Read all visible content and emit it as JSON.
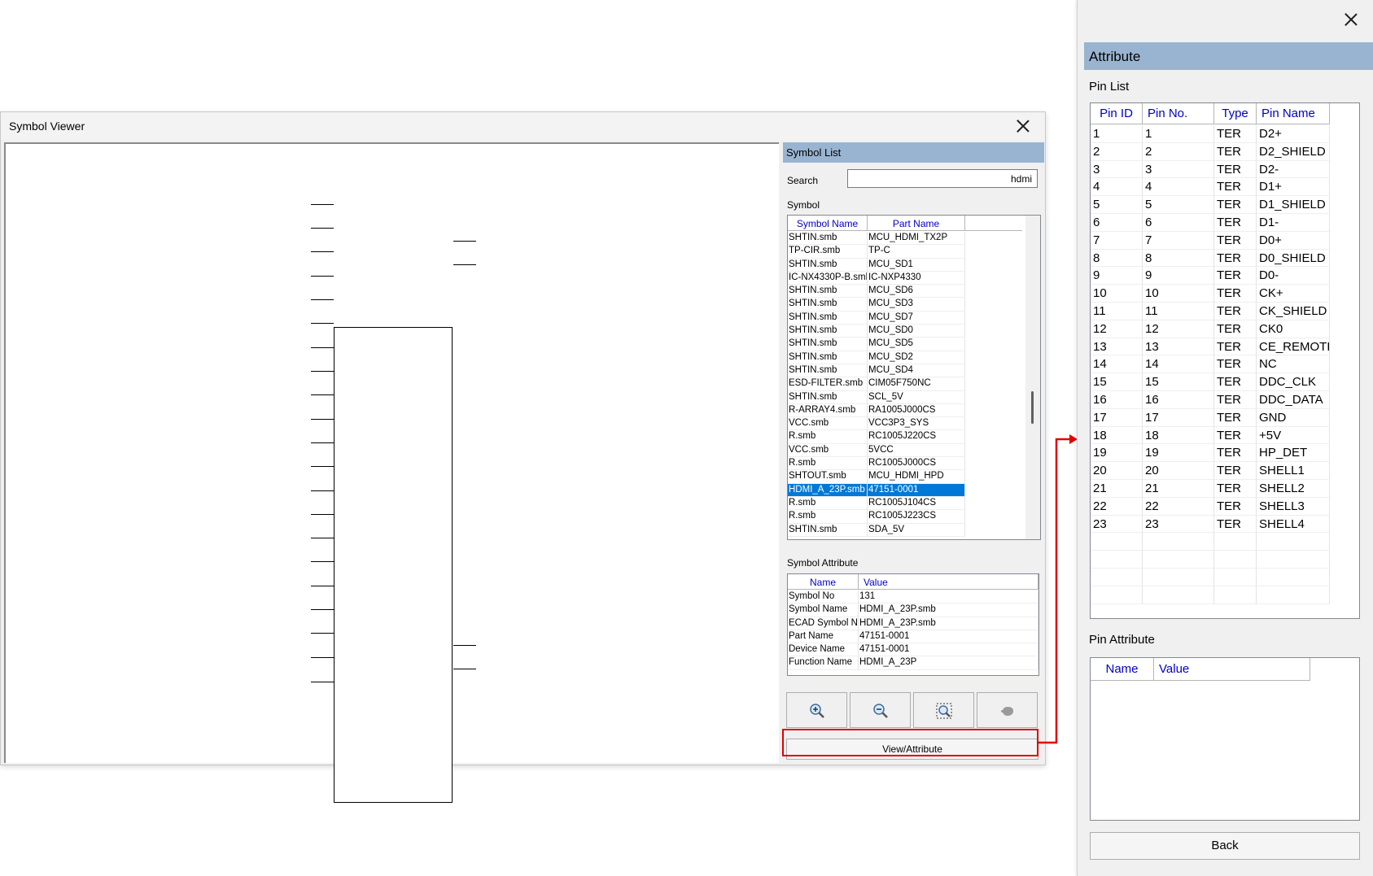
{
  "symbol_viewer": {
    "title": "Symbol Viewer",
    "symbol_list_header": "Symbol List",
    "search_label": "Search",
    "search_value": "hdmi",
    "symbol_label": "Symbol",
    "symbol_columns": [
      "Symbol Name",
      "Part Name"
    ],
    "symbols": [
      [
        "SHTIN.smb",
        "MCU_HDMI_TX2P"
      ],
      [
        "TP-CIR.smb",
        "TP-C"
      ],
      [
        "SHTIN.smb",
        "MCU_SD1"
      ],
      [
        "IC-NX4330P-B.smb",
        "IC-NXP4330"
      ],
      [
        "SHTIN.smb",
        "MCU_SD6"
      ],
      [
        "SHTIN.smb",
        "MCU_SD3"
      ],
      [
        "SHTIN.smb",
        "MCU_SD7"
      ],
      [
        "SHTIN.smb",
        "MCU_SD0"
      ],
      [
        "SHTIN.smb",
        "MCU_SD5"
      ],
      [
        "SHTIN.smb",
        "MCU_SD2"
      ],
      [
        "SHTIN.smb",
        "MCU_SD4"
      ],
      [
        "ESD-FILTER.smb",
        "CIM05F750NC"
      ],
      [
        "SHTIN.smb",
        "SCL_5V"
      ],
      [
        "R-ARRAY4.smb",
        "RA1005J000CS"
      ],
      [
        "VCC.smb",
        "VCC3P3_SYS"
      ],
      [
        "R.smb",
        "RC1005J220CS"
      ],
      [
        "VCC.smb",
        "5VCC"
      ],
      [
        "R.smb",
        "RC1005J000CS"
      ],
      [
        "SHTOUT.smb",
        "MCU_HDMI_HPD"
      ],
      [
        "HDMI_A_23P.smb",
        "47151-0001"
      ],
      [
        "R.smb",
        "RC1005J104CS"
      ],
      [
        "R.smb",
        "RC1005J223CS"
      ],
      [
        "SHTIN.smb",
        "SDA_5V"
      ]
    ],
    "selected_symbol_index": 19,
    "symbol_attribute_label": "Symbol Attribute",
    "attr_columns": [
      "Name",
      "Value"
    ],
    "attributes": [
      [
        "Symbol No",
        "131"
      ],
      [
        "Symbol Name",
        "HDMI_A_23P.smb"
      ],
      [
        "ECAD Symbol Name",
        "HDMI_A_23P.smb"
      ],
      [
        "Part Name",
        "47151-0001"
      ],
      [
        "Device Name",
        "47151-0001"
      ],
      [
        "Function Name",
        "HDMI_A_23P"
      ]
    ],
    "tools": [
      "zoom-in-icon",
      "zoom-out-icon",
      "zoom-fit-icon",
      "pan-hand-icon"
    ],
    "view_attribute_label": "View/Attribute",
    "highlight_color": "#e00000"
  },
  "attribute_panel": {
    "header": "Attribute",
    "pin_list_label": "Pin List",
    "pin_columns": [
      "Pin ID",
      "Pin No.",
      "Type",
      "Pin Name"
    ],
    "pins": [
      [
        "1",
        "1",
        "TER",
        "D2+"
      ],
      [
        "2",
        "2",
        "TER",
        "D2_SHIELD"
      ],
      [
        "3",
        "3",
        "TER",
        "D2-"
      ],
      [
        "4",
        "4",
        "TER",
        "D1+"
      ],
      [
        "5",
        "5",
        "TER",
        "D1_SHIELD"
      ],
      [
        "6",
        "6",
        "TER",
        "D1-"
      ],
      [
        "7",
        "7",
        "TER",
        "D0+"
      ],
      [
        "8",
        "8",
        "TER",
        "D0_SHIELD"
      ],
      [
        "9",
        "9",
        "TER",
        "D0-"
      ],
      [
        "10",
        "10",
        "TER",
        "CK+"
      ],
      [
        "11",
        "11",
        "TER",
        "CK_SHIELD"
      ],
      [
        "12",
        "12",
        "TER",
        "CK0"
      ],
      [
        "13",
        "13",
        "TER",
        "CE_REMOTE"
      ],
      [
        "14",
        "14",
        "TER",
        "NC"
      ],
      [
        "15",
        "15",
        "TER",
        "DDC_CLK"
      ],
      [
        "16",
        "16",
        "TER",
        "DDC_DATA"
      ],
      [
        "17",
        "17",
        "TER",
        "GND"
      ],
      [
        "18",
        "18",
        "TER",
        "+5V"
      ],
      [
        "19",
        "19",
        "TER",
        "HP_DET"
      ],
      [
        "20",
        "20",
        "TER",
        "SHELL1"
      ],
      [
        "21",
        "21",
        "TER",
        "SHELL2"
      ],
      [
        "22",
        "22",
        "TER",
        "SHELL3"
      ],
      [
        "23",
        "23",
        "TER",
        "SHELL4"
      ]
    ],
    "pin_attribute_label": "Pin Attribute",
    "pin_attr_columns": [
      "Name",
      "Value"
    ],
    "back_label": "Back"
  }
}
